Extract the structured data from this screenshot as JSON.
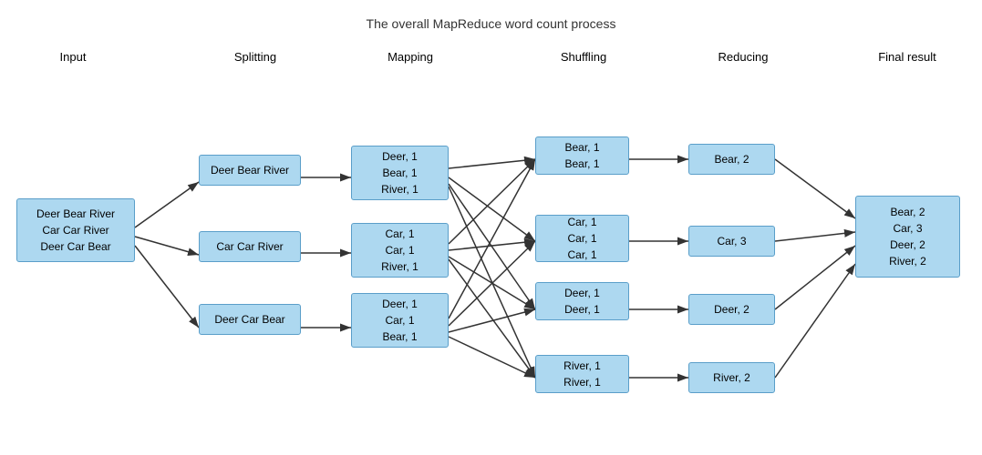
{
  "title": "The overall MapReduce word count process",
  "stages": {
    "input": "Input",
    "splitting": "Splitting",
    "mapping": "Mapping",
    "shuffling": "Shuffling",
    "reducing": "Reducing",
    "final": "Final result"
  },
  "boxes": {
    "input": "Deer Bear River\nCar Car River\nDeer Car Bear",
    "split1": "Deer Bear River",
    "split2": "Car Car River",
    "split3": "Deer Car Bear",
    "map1": "Deer, 1\nBear, 1\nRiver, 1",
    "map2": "Car, 1\nCar, 1\nRiver, 1",
    "map3": "Deer, 1\nCar, 1\nBear, 1",
    "shuf1": "Bear, 1\nBear, 1",
    "shuf2": "Car, 1\nCar, 1\nCar, 1",
    "shuf3": "Deer, 1\nDeer, 1",
    "shuf4": "River, 1\nRiver, 1",
    "red1": "Bear, 2",
    "red2": "Car, 3",
    "red3": "Deer, 2",
    "red4": "River, 2",
    "final": "Bear, 2\nCar, 3\nDeer, 2\nRiver, 2"
  }
}
